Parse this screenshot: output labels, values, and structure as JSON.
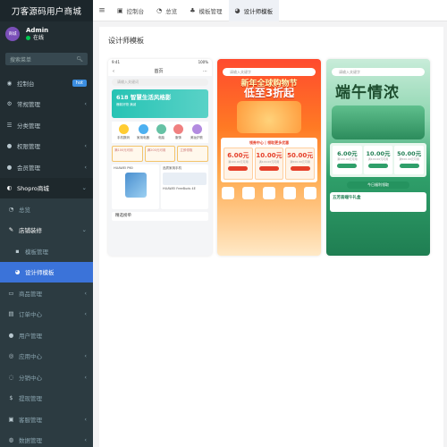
{
  "app": {
    "title": "刀客源码用户商城"
  },
  "user": {
    "avatar_text": "商城",
    "name": "Admin",
    "status": "在线"
  },
  "search": {
    "placeholder": "搜索菜单"
  },
  "menu": [
    {
      "label": "控制台",
      "icon": "dashboard-icon",
      "badge": "hot"
    },
    {
      "label": "常规管理",
      "icon": "gear-icon"
    },
    {
      "label": "分类管理",
      "icon": "list-icon"
    },
    {
      "label": "权限管理",
      "icon": "group-icon"
    },
    {
      "label": "会员管理",
      "icon": "user-icon"
    },
    {
      "label": "Shopro商城",
      "icon": "shopro-icon"
    },
    {
      "label": "总览",
      "icon": "overview-icon"
    },
    {
      "label": "店铺装修",
      "icon": "paint-icon"
    },
    {
      "label": "模板管理",
      "icon": "template-icon"
    },
    {
      "label": "设计师模板",
      "icon": "designer-icon"
    },
    {
      "label": "商品管理",
      "icon": "goods-icon"
    },
    {
      "label": "订单中心",
      "icon": "order-icon"
    },
    {
      "label": "用户管理",
      "icon": "user-icon"
    },
    {
      "label": "应用中心",
      "icon": "app-icon"
    },
    {
      "label": "分销中心",
      "icon": "share-icon"
    },
    {
      "label": "提现管理",
      "icon": "withdraw-icon"
    },
    {
      "label": "客服管理",
      "icon": "service-icon"
    },
    {
      "label": "数据管理",
      "icon": "data-icon"
    }
  ],
  "tabs": [
    {
      "label": "控制台",
      "icon": "dashboard-icon"
    },
    {
      "label": "总览",
      "icon": "overview-icon"
    },
    {
      "label": "模板管理",
      "icon": "template-icon"
    },
    {
      "label": "设计师模板",
      "icon": "designer-icon"
    }
  ],
  "page": {
    "title": "设计师模板"
  },
  "templates": {
    "t1": {
      "status_time": "9:41",
      "status_batt": "100%",
      "search": "请输入关键词",
      "nav_title": "首页",
      "banner_big": "618 智慧生活风格影",
      "banner_sm": "爆款好物 满减",
      "icons": [
        "手机数码",
        "家用电器",
        "电脑",
        "服饰",
        "美妆护肤"
      ],
      "coupons": [
        "满100元可用",
        "满200元可用",
        "立即领取"
      ],
      "prod_a": "HUAWEI P60",
      "prod_b": "品质家用手机",
      "prod_c": "HUAWEI FreeBuds 4E",
      "footer": "精选榜单"
    },
    "t2": {
      "search": "请输入关键字",
      "hdr_top": "新年全球购物节",
      "hdr_big": "低至3折起",
      "coupon_title": "领券中心 | 领取更多优惠",
      "coupons": [
        {
          "value": "6.00元",
          "desc": "满100.00元可用",
          "btn": "立即领取"
        },
        {
          "value": "10.00元",
          "desc": "满100.00元可用",
          "btn": "立即领取"
        },
        {
          "value": "50.00元",
          "desc": "满500.00元可用",
          "btn": "立即领取"
        }
      ]
    },
    "t3": {
      "search": "请输入关键字",
      "hdr": "端午情浓",
      "coupons": [
        {
          "value": "6.00元",
          "desc": "满100.00元可用",
          "btn": "立即领取"
        },
        {
          "value": "10.00元",
          "desc": "满100.00元可用",
          "btn": "立即领取"
        },
        {
          "value": "50.00元",
          "desc": "满500.00元可用",
          "btn": "立即领取"
        }
      ],
      "pill": "今日福利领取",
      "footer": "五芳斋端午礼盒"
    }
  },
  "colors": {
    "sidebar_bg": "#222d32",
    "active": "#3b73d9",
    "hot_badge": "#3b8de0"
  }
}
